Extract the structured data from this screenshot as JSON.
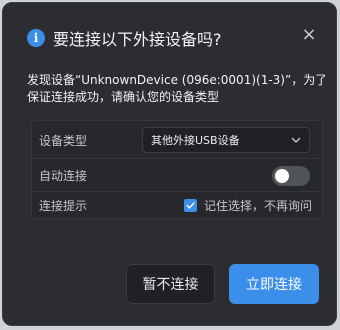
{
  "dialog": {
    "title": "要连接以下外接设备吗?",
    "icon": "info-icon",
    "close_glyph": "×",
    "message_line1": "发现设备“UnknownDevice (096e:0001)(1-3)”，为了",
    "message_line2": "保证连接成功，请确认您的设备类型"
  },
  "settings": {
    "device_type_label": "设备类型",
    "device_type_value": "其他外接USB设备",
    "auto_connect_label": "自动连接",
    "auto_connect_on": false,
    "connect_prompt_label": "连接提示",
    "remember_label": "记住选择，不再询问",
    "remember_checked": true
  },
  "buttons": {
    "cancel_label": "暂不连接",
    "confirm_label": "立即连接"
  },
  "colors": {
    "accent": "#3b8eea",
    "dialog_bg": "#2b2d31"
  }
}
